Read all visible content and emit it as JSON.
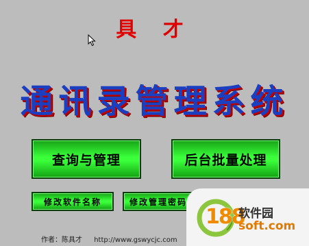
{
  "header": {
    "brand": "具 才"
  },
  "title": "通讯录管理系统",
  "buttons": {
    "query": "查询与管理",
    "batch": "后台批量处理",
    "rename": "修改软件名称",
    "password": "修改管理密码"
  },
  "footer": {
    "author": "作者：陈具才",
    "url": "http://www.gswycjc.com"
  },
  "watermark": {
    "number": "188",
    "name": "软件园",
    "domain": "soft.com"
  },
  "colors": {
    "background": "#bcbcbc",
    "brand": "#e00000",
    "title": "#1a3fc0",
    "button": "#3aff3a"
  }
}
